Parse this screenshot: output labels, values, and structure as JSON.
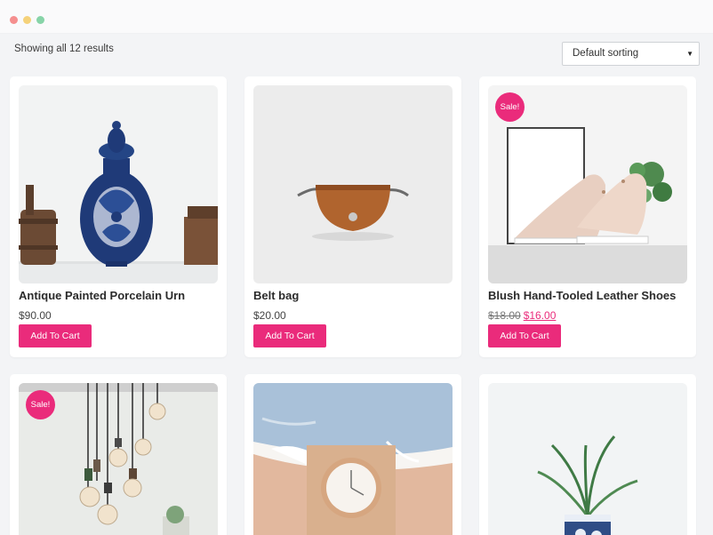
{
  "shop": {
    "result_count": "Showing all 12 results",
    "sorting": {
      "selected": "Default sorting"
    },
    "sale_label": "Sale!",
    "button_label": "Add To Cart",
    "products": [
      {
        "name": "Antique Painted Porcelain Urn",
        "price": "$90.00"
      },
      {
        "name": "Belt bag",
        "price": "$20.00"
      },
      {
        "name": "Blush Hand-Tooled Leather Shoes",
        "price_old": "$18.00",
        "price_new": "$16.00",
        "on_sale": true
      },
      {
        "name": "",
        "on_sale": true
      },
      {
        "name": ""
      },
      {
        "name": ""
      }
    ]
  },
  "colors": {
    "accent": "#ea2b7b",
    "background": "#f3f4f6"
  }
}
